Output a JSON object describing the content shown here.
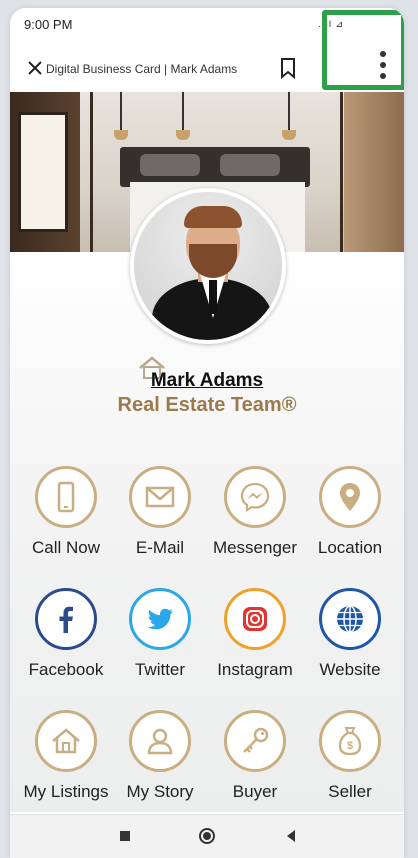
{
  "status_bar": {
    "time": "9:00 PM",
    "signal": "..ıl ⊿"
  },
  "app_bar": {
    "title": "Digital Business Card | Mark Adams"
  },
  "profile": {
    "name": "Mark Adams",
    "team": "Real Estate Team®"
  },
  "actions": [
    {
      "label": "Call Now",
      "icon": "phone-icon"
    },
    {
      "label": "E-Mail",
      "icon": "mail-icon"
    },
    {
      "label": "Messenger",
      "icon": "messenger-icon"
    },
    {
      "label": "Location",
      "icon": "location-pin-icon"
    },
    {
      "label": "Facebook",
      "icon": "facebook-icon"
    },
    {
      "label": "Twitter",
      "icon": "twitter-icon"
    },
    {
      "label": "Instagram",
      "icon": "instagram-icon"
    },
    {
      "label": "Website",
      "icon": "globe-icon"
    },
    {
      "label": "My Listings",
      "icon": "house-icon"
    },
    {
      "label": "My Story",
      "icon": "person-icon"
    },
    {
      "label": "Buyer",
      "icon": "key-icon"
    },
    {
      "label": "Seller",
      "icon": "money-bag-icon"
    }
  ],
  "colors": {
    "gold": "#c9ae82",
    "gold_text": "#9c7a4c",
    "facebook": "#2b4b8a",
    "twitter": "#2aa7e8",
    "instagram": "#e2352f",
    "website": "#1f57a6",
    "highlight": "#2fa04a"
  }
}
